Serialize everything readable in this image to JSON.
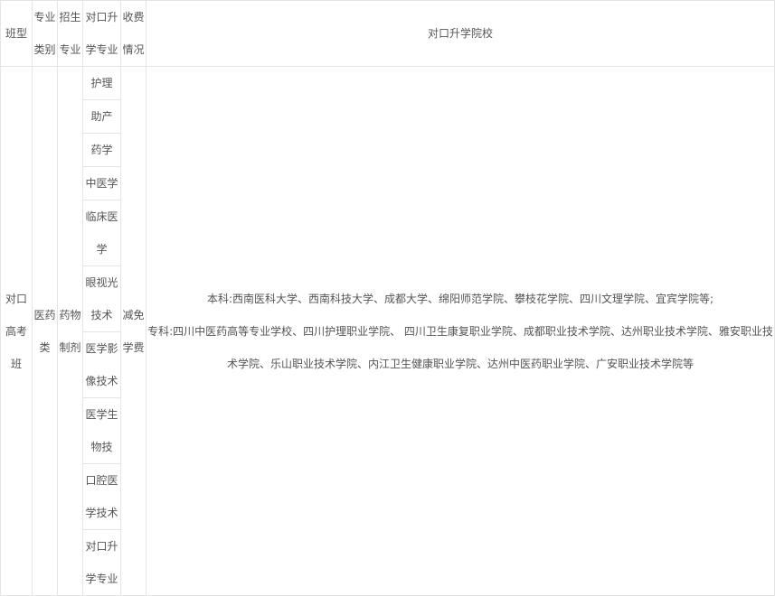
{
  "table": {
    "headers": {
      "class_type": "班型",
      "major_category": "专业类别",
      "enroll_major": "招生专业",
      "counterpart_major": "对口升学专业",
      "fee": "收费情况",
      "colleges": "对口升学院校"
    },
    "row": {
      "class_type": "对口高考班",
      "major_category": "医药类",
      "enroll_major": "药物制剂",
      "fee": "减免学费",
      "counterpart_majors": [
        "护理",
        "助产",
        "药学",
        "中医学",
        "临床医学",
        "眼视光技术",
        "医学影像技术",
        "医学生物技",
        "口腔医学技术",
        "对口升学专业"
      ],
      "colleges": {
        "undergrad": "本科:西南医科大学、西南科技大学、成都大学、绵阳师范学院、攀枝花学院、四川文理学院、宜宾学院等;",
        "junior": "专科:四川中医药高等专业学校、四川护理职业学院、 四川卫生康复职业学院、成都职业技术学院、达州职业技术学院、雅安职业技术学院、乐山职业技术学院、内江卫生健康职业学院、达州中医药职业学院、广安职业技术学院等"
      }
    }
  }
}
